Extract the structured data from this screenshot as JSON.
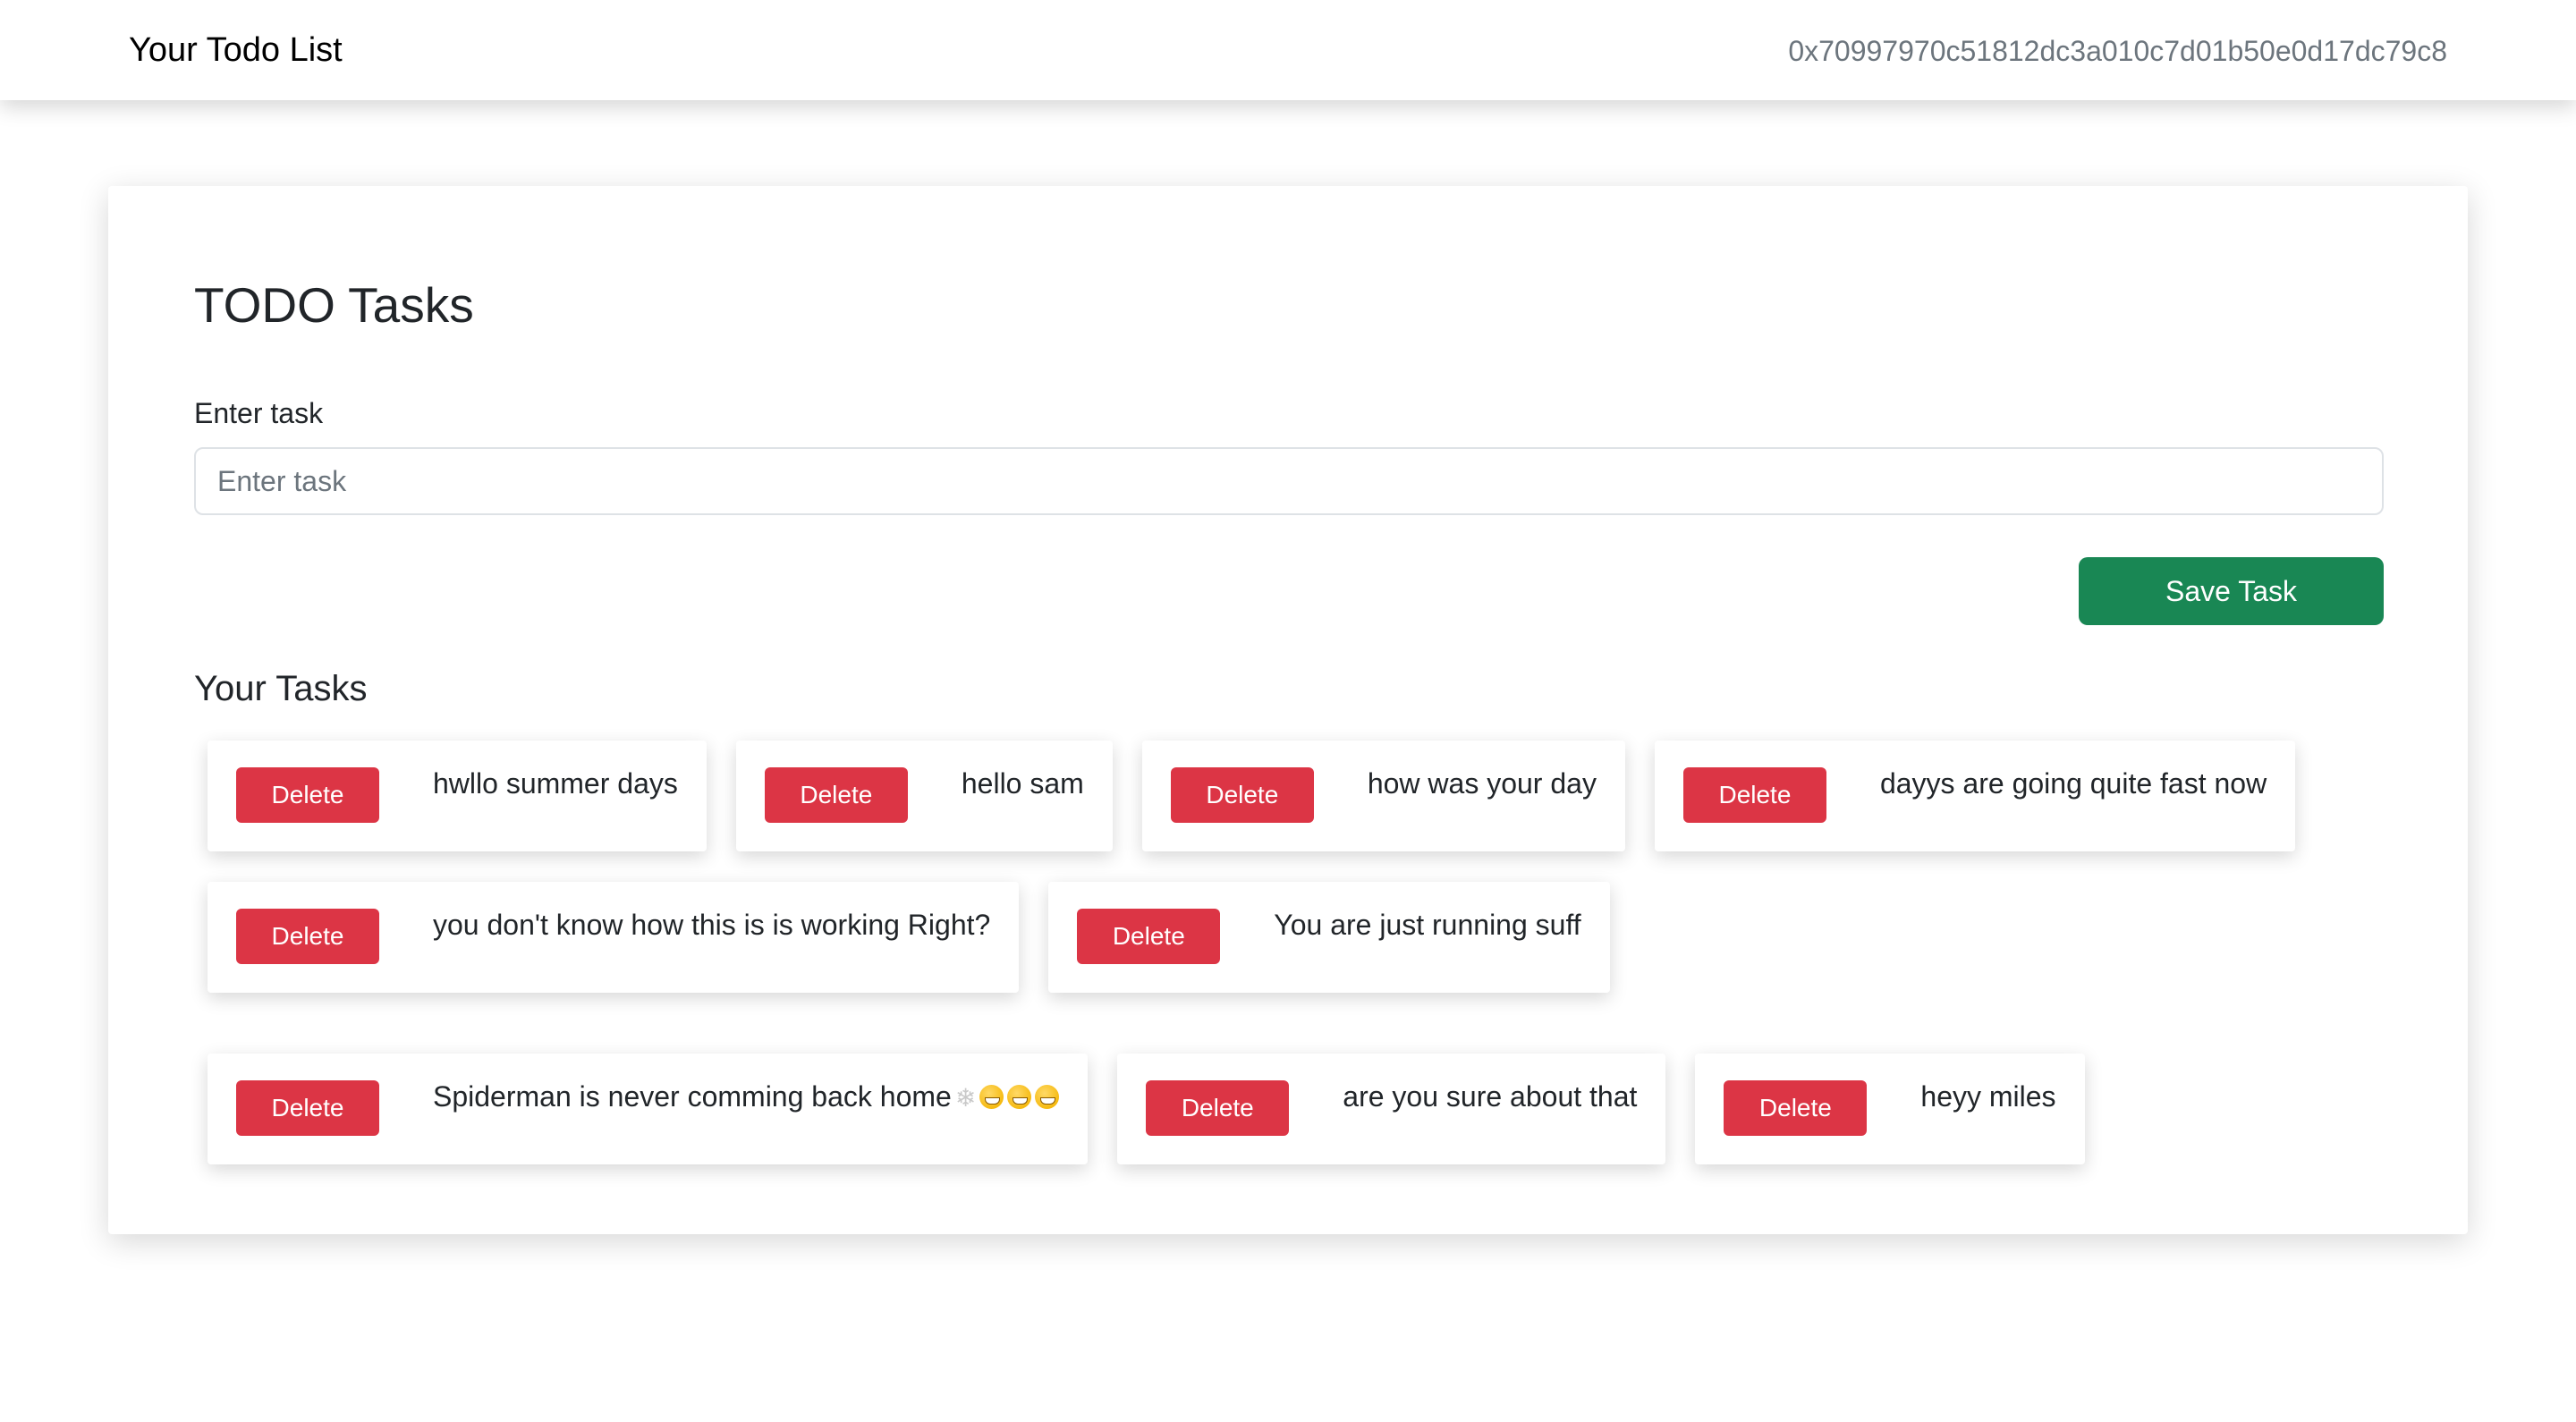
{
  "navbar": {
    "brand": "Your Todo List",
    "account": "0x70997970c51812dc3a010c7d01b50e0d17dc79c8"
  },
  "main": {
    "title": "TODO Tasks",
    "input_label": "Enter task",
    "input_placeholder": "Enter task",
    "input_value": "",
    "save_label": "Save Task",
    "tasks_heading": "Your Tasks",
    "delete_label": "Delete",
    "tasks": [
      {
        "text": "hwllo summer days"
      },
      {
        "text": "hello sam"
      },
      {
        "text": "how was your day"
      },
      {
        "text": "dayys are going quite fast now"
      },
      {
        "text": "you don't know how this is is working Right?"
      },
      {
        "text": "You are just running suff"
      },
      {
        "text": "Spiderman is never comming back home",
        "emoji": "🕸️😁😁😁"
      },
      {
        "text": "are you sure about that"
      },
      {
        "text": "heyy miles"
      }
    ]
  },
  "colors": {
    "save_button": "#198754",
    "delete_button": "#dc3545",
    "text": "#212529",
    "muted_text": "#6c757d"
  },
  "icons": {
    "task_emoji": [
      "spider-web-icon",
      "grinning-face-icon",
      "grinning-face-icon",
      "grinning-face-icon"
    ]
  }
}
